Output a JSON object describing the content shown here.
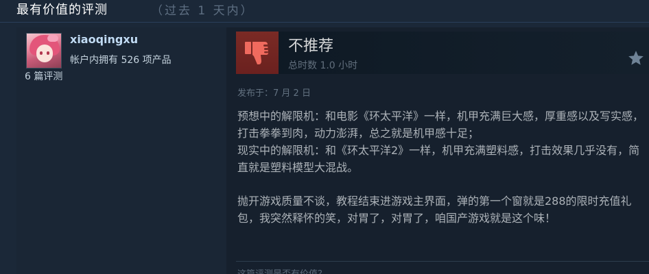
{
  "section": {
    "title": "最有价值的评测",
    "range": "（过去 1 天内）"
  },
  "reviewer": {
    "name": "xiaoqingxu",
    "products": "帐户内拥有 526 项产品",
    "reviews": "6 篇评测"
  },
  "review": {
    "verdict": "不推荐",
    "hours": "总时数 1.0 小时",
    "posted": "发布于：7 月 2 日",
    "paragraph1": "预想中的解限机：和电影《环太平洋》一样，机甲充满巨大感，厚重感以及写实感，打击拳拳到肉，动力澎湃，总之就是机甲感十足；\n现实中的解限机：和《环太平洋2》一样，机甲充满塑料感，打击效果几乎没有，简直就是塑料模型大混战。",
    "paragraph2": "抛开游戏质量不谈，教程结束进游戏主界面，弹的第一个窗就是288的限时充值礼包，我突然释怀的笑，对胃了，对胃了，咱国产游戏就是这个味！",
    "helpful_prompt": "这篇评测是否有价值？"
  },
  "icons": {
    "verdict_icon": "thumbs-down-icon",
    "award_icon": "star-icon"
  },
  "colors": {
    "background": "#1b2838",
    "thumb_bg": "#7a2a25",
    "username": "#c1dbf4"
  }
}
